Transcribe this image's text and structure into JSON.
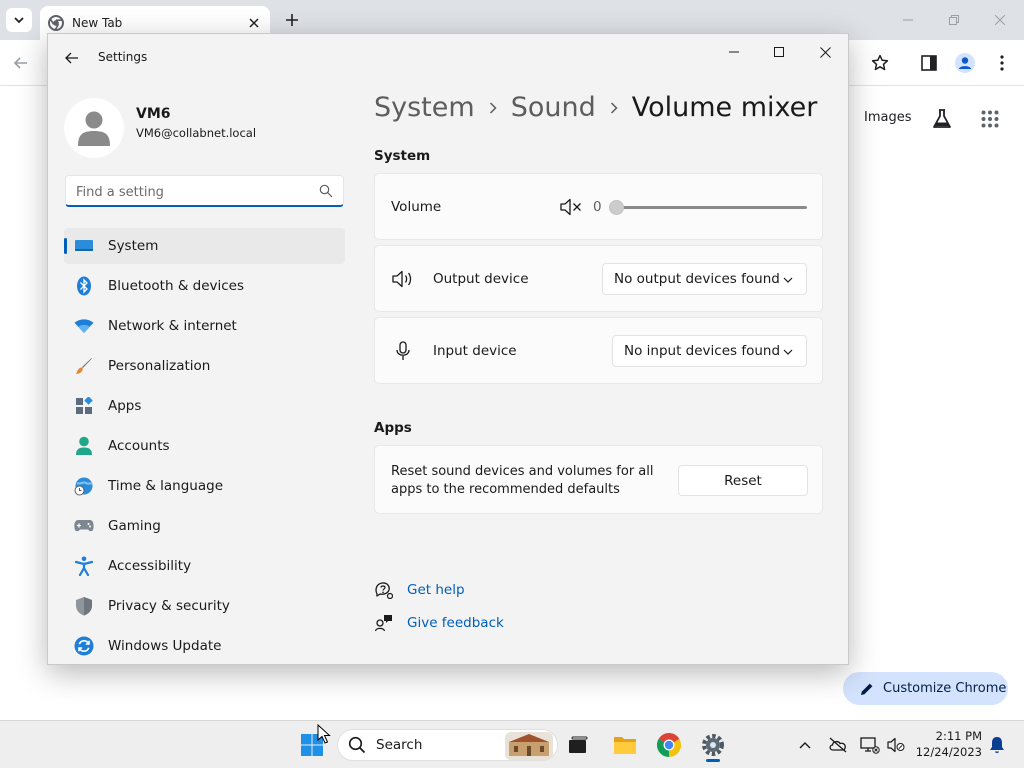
{
  "browser": {
    "tab_title": "New Tab",
    "ntp_images_link": "Images",
    "customize_label": "Customize Chrome"
  },
  "settings": {
    "window_title": "Settings",
    "user": {
      "name": "VM6",
      "email": "VM6@collabnet.local"
    },
    "search": {
      "placeholder": "Find a setting",
      "value": ""
    },
    "nav": [
      {
        "label": "System",
        "icon": "system-icon",
        "active": true
      },
      {
        "label": "Bluetooth & devices",
        "icon": "bluetooth-icon"
      },
      {
        "label": "Network & internet",
        "icon": "network-icon"
      },
      {
        "label": "Personalization",
        "icon": "brush-icon"
      },
      {
        "label": "Apps",
        "icon": "apps-icon"
      },
      {
        "label": "Accounts",
        "icon": "accounts-icon"
      },
      {
        "label": "Time & language",
        "icon": "globe-clock-icon"
      },
      {
        "label": "Gaming",
        "icon": "gamepad-icon"
      },
      {
        "label": "Accessibility",
        "icon": "accessibility-icon"
      },
      {
        "label": "Privacy & security",
        "icon": "shield-icon"
      },
      {
        "label": "Windows Update",
        "icon": "update-icon"
      }
    ],
    "breadcrumb": {
      "part1": "System",
      "part2": "Sound",
      "current": "Volume mixer"
    },
    "system_section": {
      "header": "System",
      "volume_label": "Volume",
      "volume_value": "0",
      "volume_level": 0,
      "output_label": "Output device",
      "output_selected": "No output devices found",
      "input_label": "Input device",
      "input_selected": "No input devices found"
    },
    "apps_section": {
      "header": "Apps",
      "reset_text": "Reset sound devices and volumes for all apps to the recommended defaults",
      "reset_label": "Reset"
    },
    "links": {
      "help": "Get help",
      "feedback": "Give feedback"
    }
  },
  "taskbar": {
    "search_label": "Search",
    "time": "2:11 PM",
    "date": "12/24/2023"
  },
  "colors": {
    "accent": "#005fb8",
    "chrome_frame": "#dee1e6",
    "settings_bg": "#f3f3f3",
    "customize_bg": "#d3e3fd"
  }
}
